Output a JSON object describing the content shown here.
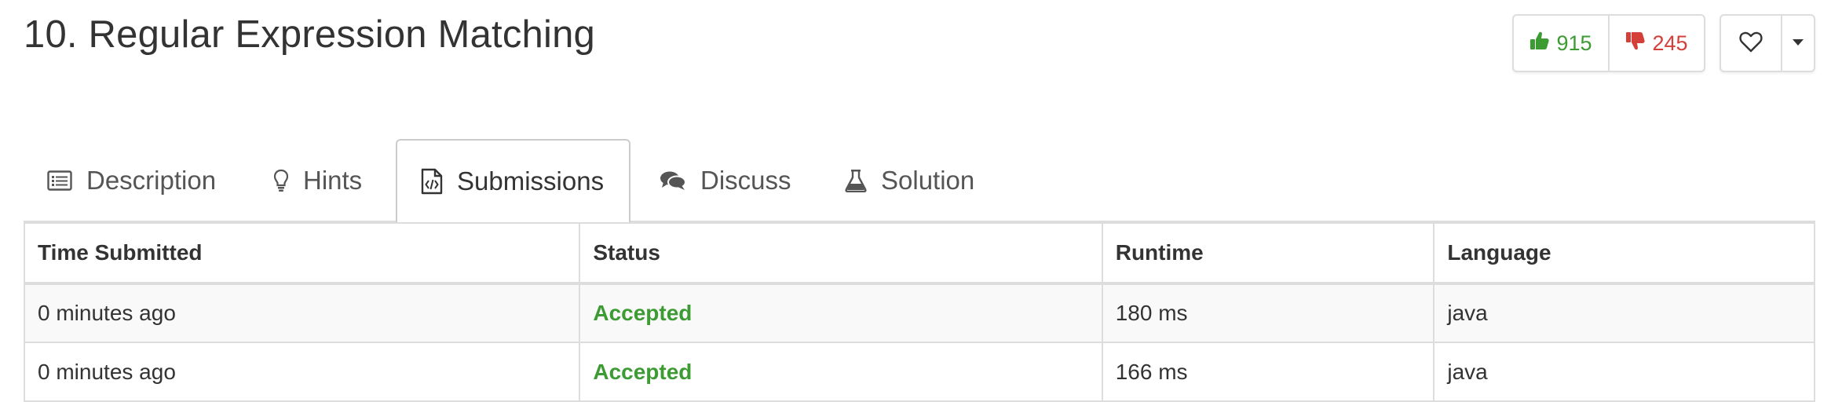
{
  "problem": {
    "title": "10. Regular Expression Matching"
  },
  "votes": {
    "up_count": "915",
    "down_count": "245",
    "up_color": "#3d9b34",
    "down_color": "#d43f3a",
    "up_icon": "thumbs-up-icon",
    "down_icon": "thumbs-down-icon",
    "favorite_icon": "heart-outline-icon",
    "more_icon": "caret-down-icon"
  },
  "tabs": [
    {
      "label": "Description",
      "icon": "list-alt-icon",
      "active": false
    },
    {
      "label": "Hints",
      "icon": "lightbulb-icon",
      "active": false
    },
    {
      "label": "Submissions",
      "icon": "code-file-icon",
      "active": true
    },
    {
      "label": "Discuss",
      "icon": "comments-icon",
      "active": false
    },
    {
      "label": "Solution",
      "icon": "flask-icon",
      "active": false
    }
  ],
  "submissions": {
    "columns": [
      "Time Submitted",
      "Status",
      "Runtime",
      "Language"
    ],
    "rows": [
      {
        "time": "0 minutes ago",
        "status": "Accepted",
        "runtime": "180 ms",
        "language": "java"
      },
      {
        "time": "0 minutes ago",
        "status": "Accepted",
        "runtime": "166 ms",
        "language": "java"
      }
    ],
    "accepted_color": "#3d9b34"
  }
}
